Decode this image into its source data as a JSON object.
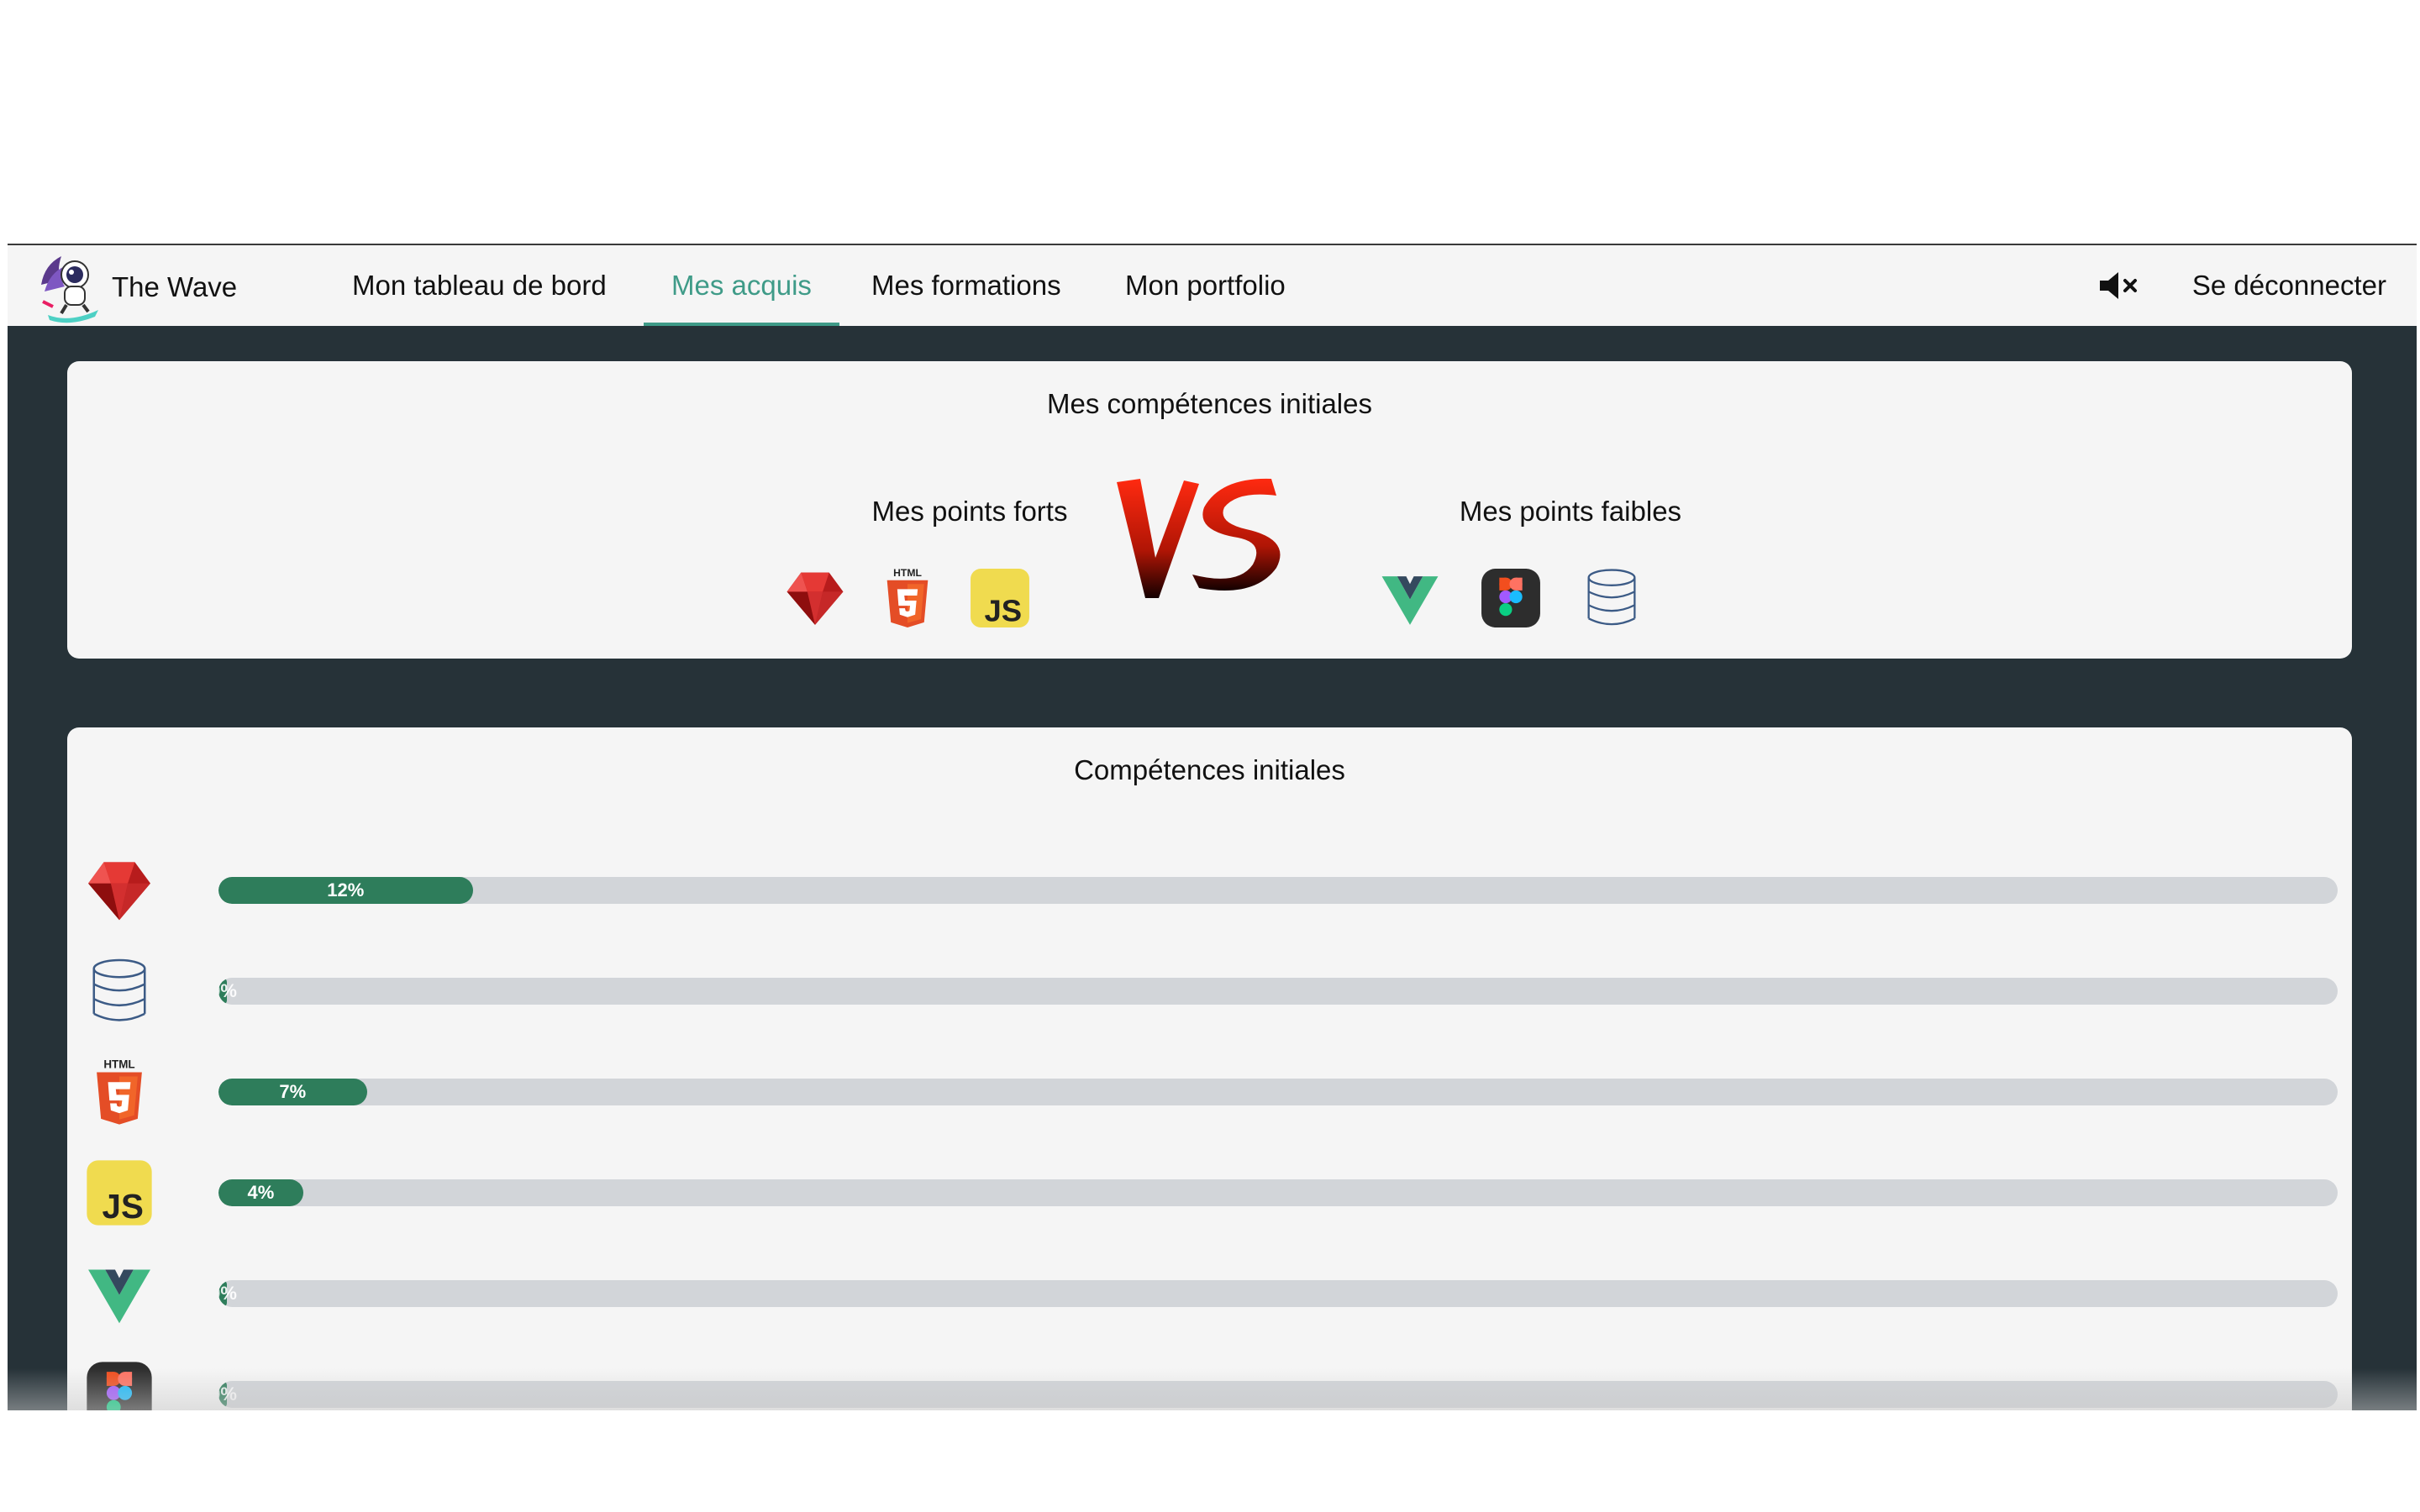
{
  "brand": {
    "name": "The Wave"
  },
  "nav": {
    "items": [
      {
        "label": "Mon tableau de bord"
      },
      {
        "label": "Mes acquis",
        "active": true
      },
      {
        "label": "Mes formations"
      },
      {
        "label": "Mon portfolio"
      }
    ],
    "logout_label": "Se déconnecter",
    "mute_icon": "speaker-muted-icon"
  },
  "initial": {
    "title": "Mes compétences initiales",
    "strengths": {
      "title": "Mes points forts",
      "icons": [
        "ruby-icon",
        "html5-icon",
        "javascript-icon"
      ]
    },
    "weaknesses": {
      "title": "Mes points faibles",
      "icons": [
        "vue-icon",
        "figma-icon",
        "database-icon"
      ]
    }
  },
  "skills": {
    "title": "Compétences initiales",
    "rows": [
      {
        "icon": "ruby-icon",
        "progress": 12,
        "label": "12%"
      },
      {
        "icon": "database-icon",
        "progress": 0,
        "label": "0%"
      },
      {
        "icon": "html5-icon",
        "progress": 7,
        "label": "7%"
      },
      {
        "icon": "javascript-icon",
        "progress": 4,
        "label": "4%"
      },
      {
        "icon": "vue-icon",
        "progress": 0,
        "label": "0%"
      },
      {
        "icon": "figma-icon",
        "progress": 0,
        "label": "0%"
      }
    ]
  },
  "colors": {
    "accent": "#3f9b88",
    "progress": "#2e7d5b",
    "background": "#263238",
    "card": "#f5f5f5"
  }
}
